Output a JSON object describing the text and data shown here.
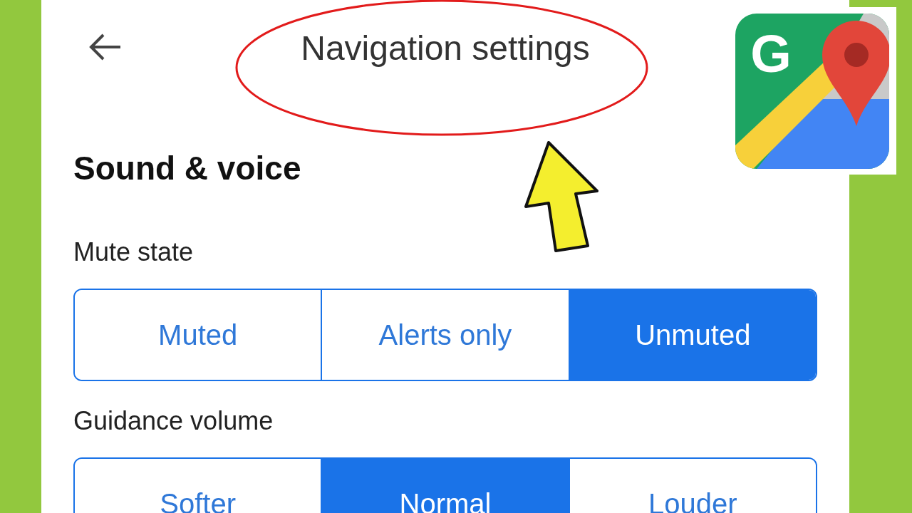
{
  "header": {
    "title": "Navigation settings"
  },
  "logo": {
    "letter": "G"
  },
  "sections": [
    {
      "title": "Sound & voice",
      "settings": [
        {
          "label": "Mute state",
          "options": [
            {
              "label": "Muted",
              "selected": false
            },
            {
              "label": "Alerts only",
              "selected": false
            },
            {
              "label": "Unmuted",
              "selected": true
            }
          ]
        },
        {
          "label": "Guidance volume",
          "options": [
            {
              "label": "Softer",
              "selected": false
            },
            {
              "label": "Normal",
              "selected": true
            },
            {
              "label": "Louder",
              "selected": false
            }
          ]
        }
      ]
    }
  ]
}
